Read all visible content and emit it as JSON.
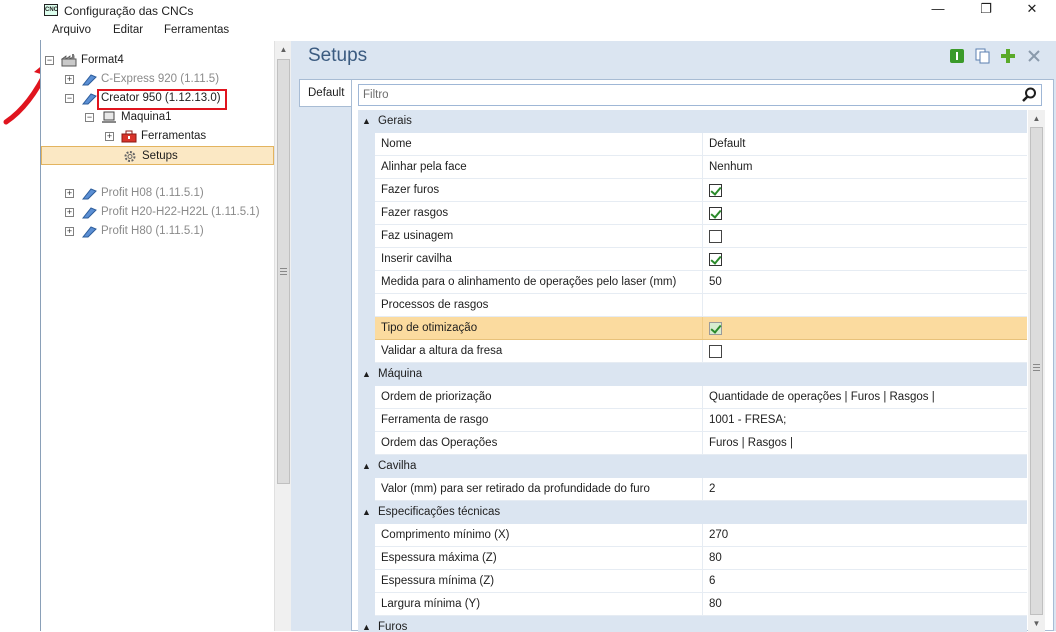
{
  "window": {
    "title": "Configuração das CNCs",
    "app_icon_text": "CNC",
    "minimize": "—",
    "maximize": "❐",
    "close": "✕"
  },
  "menu": [
    "Arquivo",
    "Editar",
    "Ferramentas"
  ],
  "tree": {
    "root": "Format4",
    "items": [
      {
        "label": "C-Express 920 (1.11.5)",
        "dim": true
      },
      {
        "label": "Creator 950 (1.12.13.0)",
        "dim": false
      },
      {
        "label": "Maquina1",
        "dim": false
      },
      {
        "label": "Ferramentas",
        "dim": false
      },
      {
        "label": "Setups",
        "dim": false
      },
      {
        "label": "Profit H08 (1.11.5.1)",
        "dim": true
      },
      {
        "label": "Profit H20-H22-H22L (1.11.5.1)",
        "dim": true
      },
      {
        "label": "Profit H80 (1.11.5.1)",
        "dim": true
      }
    ]
  },
  "panel": {
    "title": "Setups",
    "tab": "Default",
    "filter_placeholder": "Filtro"
  },
  "grid": {
    "gerais": {
      "title": "Gerais",
      "rows": [
        {
          "name": "Nome",
          "value": "Default"
        },
        {
          "name": "Alinhar pela face",
          "value": "Nenhum"
        },
        {
          "name": "Fazer furos",
          "checked": true
        },
        {
          "name": "Fazer rasgos",
          "checked": true
        },
        {
          "name": "Faz usinagem",
          "checked": false
        },
        {
          "name": "Inserir cavilha",
          "checked": true
        },
        {
          "name": "Medida para o alinhamento de operações pelo laser (mm)",
          "value": "50"
        },
        {
          "name": "Processos de rasgos",
          "value": ""
        },
        {
          "name": "Tipo de otimização",
          "checked": true
        },
        {
          "name": "Validar a altura da fresa",
          "checked": false
        }
      ]
    },
    "maquina": {
      "title": "Máquina",
      "rows": [
        {
          "name": "Ordem de priorização",
          "value": "Quantidade de operações | Furos | Rasgos |"
        },
        {
          "name": "Ferramenta de rasgo",
          "value": "1001 - FRESA;"
        },
        {
          "name": "Ordem das Operações",
          "value": "Furos | Rasgos |"
        }
      ]
    },
    "cavilha": {
      "title": "Cavilha",
      "rows": [
        {
          "name": "Valor (mm) para ser retirado da profundidade do furo",
          "value": "2"
        }
      ]
    },
    "especificacoes": {
      "title": "Especificações técnicas",
      "rows": [
        {
          "name": "Comprimento mínimo (X)",
          "value": "270"
        },
        {
          "name": "Espessura máxima (Z)",
          "value": "80"
        },
        {
          "name": "Espessura mínima (Z)",
          "value": "6"
        },
        {
          "name": "Largura mínima (Y)",
          "value": "80"
        }
      ]
    },
    "furos": {
      "title": "Furos"
    }
  }
}
